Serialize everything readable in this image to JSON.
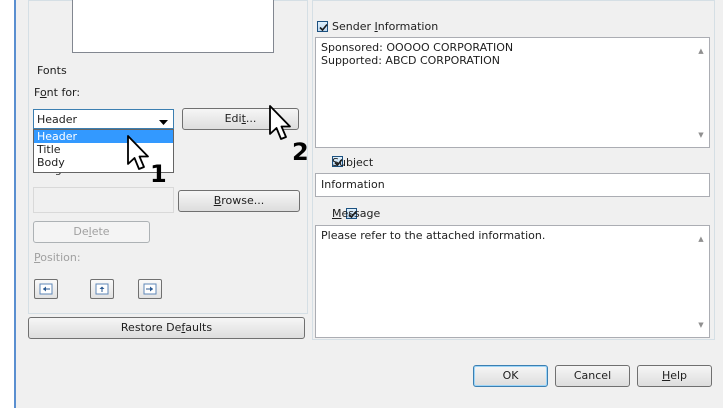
{
  "fonts": {
    "group_label": "Fonts",
    "font_for_label": "Font for:",
    "selected_value": "Header",
    "options": [
      "Header",
      "Title",
      "Body"
    ],
    "edit_button": "Edit..."
  },
  "image": {
    "image_file_label": "Image File:",
    "browse_button": "Browse...",
    "delete_button": "Delete",
    "position_label": "Position:"
  },
  "restore_button": "Restore Defaults",
  "sender": {
    "label": "Sender Information",
    "checked": true,
    "text": "Sponsored: OOOOO CORPORATION\nSupported: ABCD CORPORATION"
  },
  "subject": {
    "label": "Subject",
    "checked": true,
    "value": "Information"
  },
  "message": {
    "label": "Message",
    "checked": true,
    "text": "Please refer to the attached information."
  },
  "footer": {
    "ok_button": "OK",
    "cancel_button": "Cancel",
    "help_button": "Help"
  },
  "callouts": {
    "step1": "1",
    "step2": "2"
  }
}
